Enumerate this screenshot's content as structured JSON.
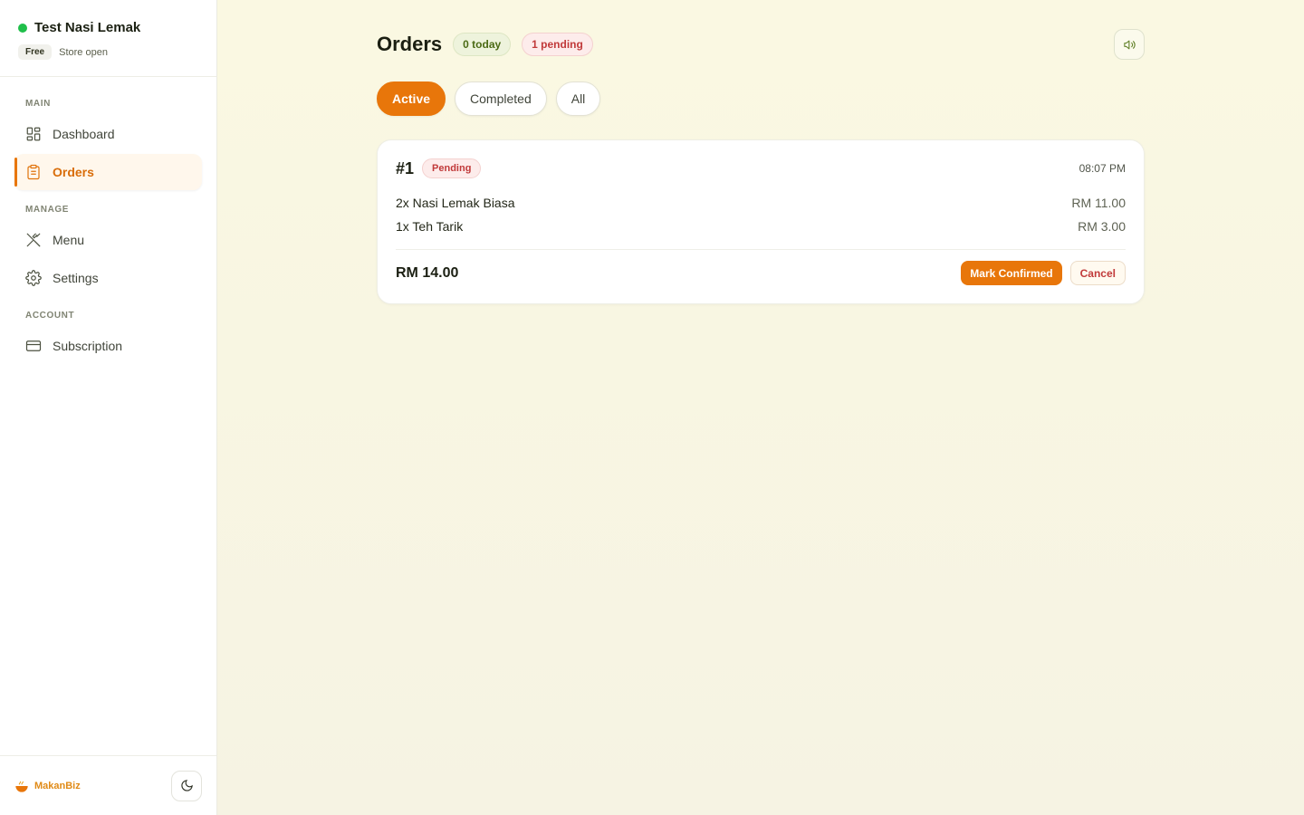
{
  "store": {
    "name": "Test Nasi Lemak",
    "plan": "Free",
    "status": "Store open",
    "status_color": "#1fbf4a"
  },
  "sidebar": {
    "sections": [
      {
        "title": "MAIN",
        "items": [
          {
            "label": "Dashboard",
            "icon": "grid-icon"
          },
          {
            "label": "Orders",
            "icon": "clipboard-icon",
            "active": true
          }
        ]
      },
      {
        "title": "MANAGE",
        "items": [
          {
            "label": "Menu",
            "icon": "utensils-icon"
          },
          {
            "label": "Settings",
            "icon": "gear-icon"
          }
        ]
      },
      {
        "title": "ACCOUNT",
        "items": [
          {
            "label": "Subscription",
            "icon": "credit-card-icon"
          }
        ]
      }
    ],
    "brand": "MakanBiz",
    "theme_toggle_icon": "moon-icon"
  },
  "header": {
    "title": "Orders",
    "today_badge": "0 today",
    "pending_badge": "1 pending",
    "sound_icon": "speaker-icon"
  },
  "tabs": [
    {
      "label": "Active",
      "active": true
    },
    {
      "label": "Completed"
    },
    {
      "label": "All"
    }
  ],
  "orders": [
    {
      "id": "#1",
      "status": "Pending",
      "time": "08:07 PM",
      "items": [
        {
          "name": "2x Nasi Lemak Biasa",
          "price": "RM 11.00"
        },
        {
          "name": "1x Teh Tarik",
          "price": "RM 3.00"
        }
      ],
      "total": "RM 14.00",
      "confirm_label": "Mark Confirmed",
      "cancel_label": "Cancel"
    }
  ],
  "colors": {
    "accent": "#e8760a",
    "danger": "#c13a3a",
    "success": "#4b6a14"
  }
}
